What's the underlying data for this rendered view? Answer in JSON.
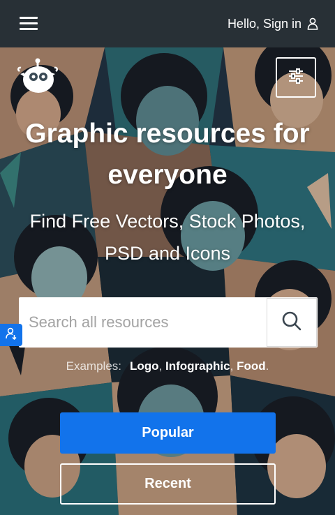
{
  "header": {
    "menu_icon": "hamburger-icon",
    "signin_label": "Hello, Sign in",
    "user_icon": "user-icon"
  },
  "hero": {
    "logo_icon": "freepik-logo-icon",
    "filter_icon": "sliders-icon",
    "headline_line1": "Graphic resources for",
    "headline_line2": "everyone",
    "subline_line1": "Find Free Vectors, Stock Photos,",
    "subline_line2": "PSD and Icons"
  },
  "search": {
    "placeholder": "Search all resources",
    "value": "",
    "button_icon": "search-icon"
  },
  "side_tab_icon": "user-upload-icon",
  "examples": {
    "label": "Examples:",
    "items": [
      "Logo",
      "Infographic",
      "Food"
    ],
    "separator": ",",
    "end": "."
  },
  "buttons": {
    "popular": "Popular",
    "recent": "Recent"
  },
  "colors": {
    "topbar": "#283036",
    "accent": "#1273eb",
    "text": "#ffffff"
  }
}
